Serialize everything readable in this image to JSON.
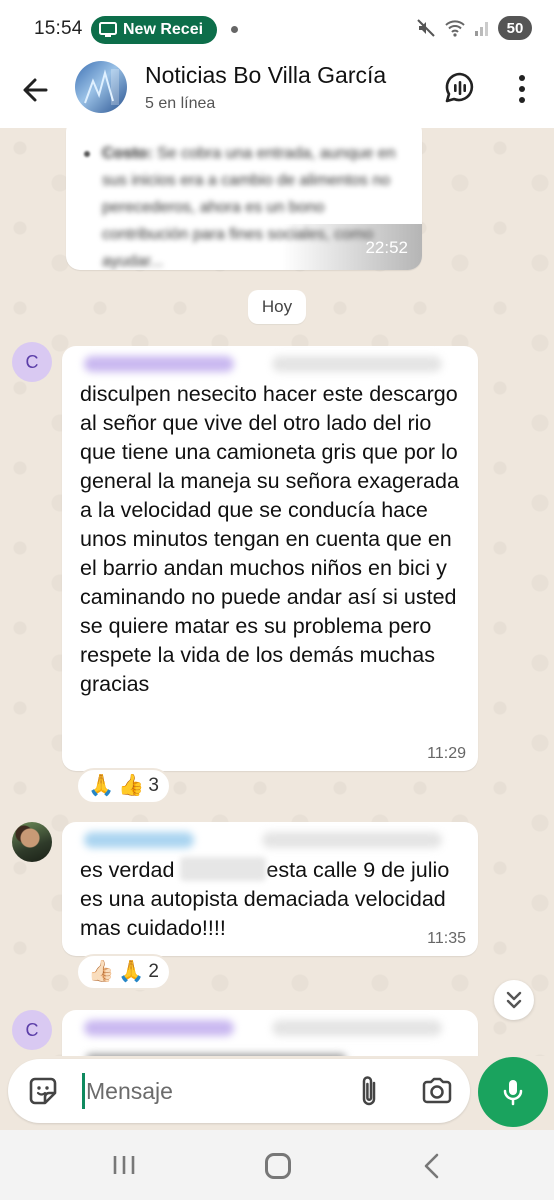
{
  "status_bar": {
    "time": "15:54",
    "notification_pill": "New Recei",
    "battery": "50"
  },
  "header": {
    "title": "Noticias Bo Villa García",
    "subtitle": "5 en línea"
  },
  "messages": {
    "top_bubble": {
      "label": "Costo:",
      "text": "Se cobra una entrada, aunque en sus inicios era a cambio de alimentos no perecederos, ahora es un bono contribución para fines sociales, como ayudar...",
      "time": "22:52"
    },
    "date_chip": "Hoy",
    "msg1": {
      "avatar_letter": "C",
      "text": "disculpen nesecito hacer este descargo al señor que vive del otro lado del rio que tiene una camioneta gris que por lo general la maneja su señora exagerada a la velocidad que se conducía hace unos minutos tengan en cuenta que en el barrio andan muchos niños en bici y caminando no puede andar así si usted se quiere matar es su problema pero respete la vida de los demás muchas gracias",
      "time": "11:29",
      "reactions": {
        "emoji1": "🙏",
        "emoji2": "👍",
        "count": "3"
      }
    },
    "msg2": {
      "text_before": "es verdad",
      "text_after": "esta calle 9 de julio es una autopista demaciada velocidad mas cuidado!!!!",
      "time": "11:35",
      "reactions": {
        "emoji1": "👍🏻",
        "emoji2": "🙏",
        "count": "2"
      }
    },
    "msg3": {
      "avatar_letter": "C"
    }
  },
  "composer": {
    "placeholder": "Mensaje"
  },
  "colors": {
    "accent": "#1aa35e",
    "pill": "#0d6e4a",
    "chat_bg": "#efe7dd"
  }
}
